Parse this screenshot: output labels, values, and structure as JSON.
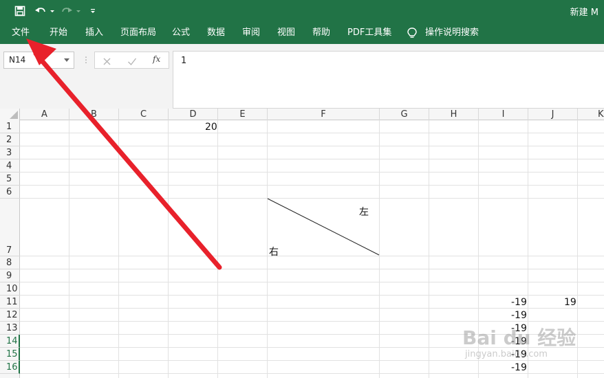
{
  "titlebar": {
    "title": "新建 M",
    "save_icon": "save-icon",
    "undo_icon": "undo-icon",
    "redo_icon": "redo-icon",
    "customize_icon": "customize-qat-icon"
  },
  "ribbon": {
    "tabs": [
      "文件",
      "开始",
      "插入",
      "页面布局",
      "公式",
      "数据",
      "审阅",
      "视图",
      "帮助",
      "PDF工具集"
    ],
    "search_icon": "lightbulb-icon",
    "search_label": "操作说明搜索"
  },
  "formula": {
    "namebox": "N14",
    "cancel_icon": "cancel-icon",
    "enter_icon": "check-icon",
    "fx_label": "fx",
    "value": "1"
  },
  "grid": {
    "columns": [
      "A",
      "B",
      "C",
      "D",
      "E",
      "F",
      "G",
      "H",
      "I",
      "J",
      "K"
    ],
    "rows": [
      "1",
      "2",
      "3",
      "4",
      "5",
      "6",
      "7",
      "8",
      "9",
      "10",
      "11",
      "12",
      "13",
      "14",
      "15",
      "16"
    ],
    "cells": {
      "D1": "20",
      "F7_right": "左",
      "F7_left": "右",
      "I11": "-19",
      "J11": "19",
      "I12": "-19",
      "I13": "-19",
      "I14": "-19",
      "I15": "-19",
      "I16": "-19"
    }
  },
  "watermark": {
    "main": "Bai du 经验",
    "sub": "jingyan.baidu.com"
  },
  "colors": {
    "brand_green": "#217346",
    "arrow_red": "#e8212b"
  }
}
